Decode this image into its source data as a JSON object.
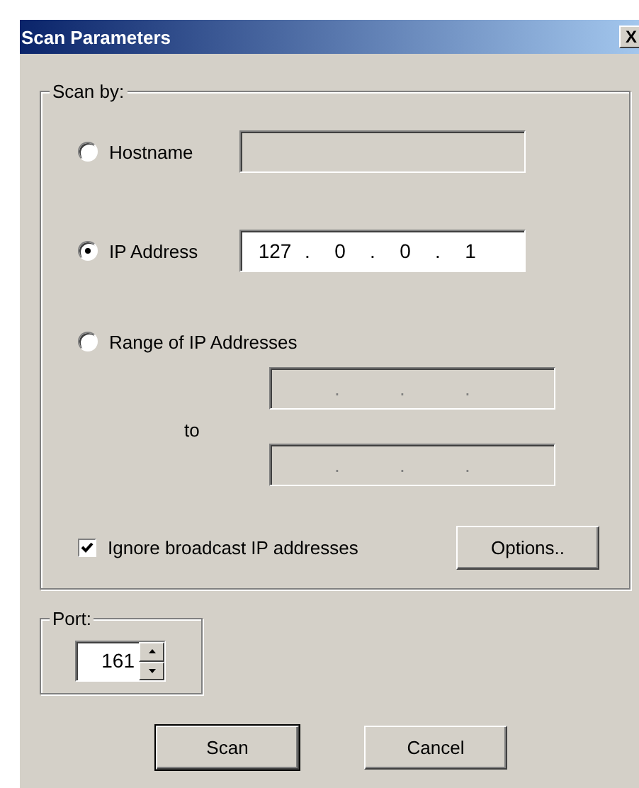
{
  "window": {
    "title": "Scan Parameters",
    "close_label": "X"
  },
  "scan_by": {
    "legend": "Scan by:",
    "options": [
      {
        "label": "Hostname",
        "selected": false
      },
      {
        "label": "IP Address",
        "selected": true
      },
      {
        "label": "Range of IP Addresses",
        "selected": false
      }
    ],
    "hostname_field": {
      "disabled": true
    },
    "ip_field": {
      "octets": [
        "127",
        "0",
        "0",
        "1"
      ],
      "separator": ".",
      "disabled": false
    },
    "range_from": {
      "separator": ".",
      "disabled": true
    },
    "range_to_label": "to",
    "range_to": {
      "separator": ".",
      "disabled": true
    },
    "ignore_broadcast": {
      "label": "Ignore broadcast IP addresses",
      "checked": true
    },
    "options_button": "Options.."
  },
  "port": {
    "legend": "Port:",
    "value": "161"
  },
  "buttons": [
    {
      "label": "Scan",
      "default": true
    },
    {
      "label": "Cancel",
      "default": false
    }
  ]
}
